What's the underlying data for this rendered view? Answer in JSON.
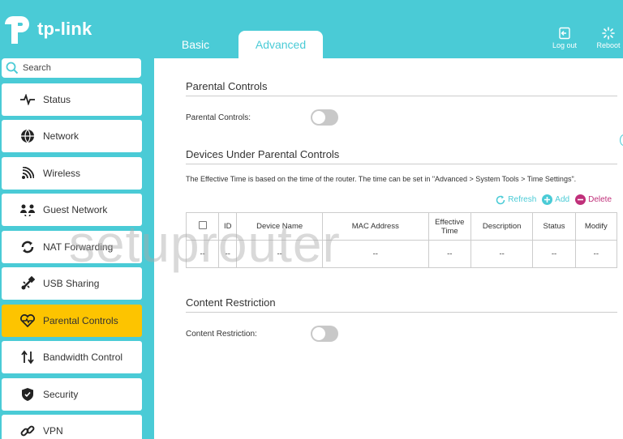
{
  "brand": {
    "logo_text": "tp-link",
    "accent": "#4acbd6",
    "active_nav": "#fdc400"
  },
  "tabs": [
    {
      "label": "Basic",
      "active": false
    },
    {
      "label": "Advanced",
      "active": true
    }
  ],
  "header_buttons": {
    "logout": "Log out",
    "reboot": "Reboot"
  },
  "search": {
    "placeholder": "Search"
  },
  "sidebar": {
    "items": [
      {
        "label": "Status",
        "icon": "pulse-icon"
      },
      {
        "label": "Network",
        "icon": "globe-icon"
      },
      {
        "label": "Wireless",
        "icon": "wifi-icon"
      },
      {
        "label": "Guest Network",
        "icon": "guests-icon"
      },
      {
        "label": "NAT Forwarding",
        "icon": "nat-icon"
      },
      {
        "label": "USB Sharing",
        "icon": "usb-icon"
      },
      {
        "label": "Parental Controls",
        "icon": "heart-icon",
        "active": true
      },
      {
        "label": "Bandwidth Control",
        "icon": "updown-arrows-icon"
      },
      {
        "label": "Security",
        "icon": "shield-icon"
      },
      {
        "label": "VPN",
        "icon": "link-icon"
      }
    ]
  },
  "main": {
    "parental": {
      "title": "Parental Controls",
      "label": "Parental Controls:",
      "enabled": false
    },
    "devices": {
      "title": "Devices Under Parental Controls",
      "note": "The Effective Time is based on the time of the router. The time can be set in \"Advanced > System Tools > Time Settings\".",
      "actions": {
        "refresh": "Refresh",
        "add": "Add",
        "delete": "Delete"
      },
      "table": {
        "headers": [
          "",
          "ID",
          "Device Name",
          "MAC Address",
          "Effective Time",
          "Description",
          "Status",
          "Modify"
        ],
        "rows": [
          [
            "--",
            "--",
            "--",
            "--",
            "--",
            "--",
            "--",
            "--"
          ]
        ]
      }
    },
    "content": {
      "title": "Content Restriction",
      "label": "Content Restriction:",
      "enabled": false
    }
  },
  "watermark": "setuprouter"
}
